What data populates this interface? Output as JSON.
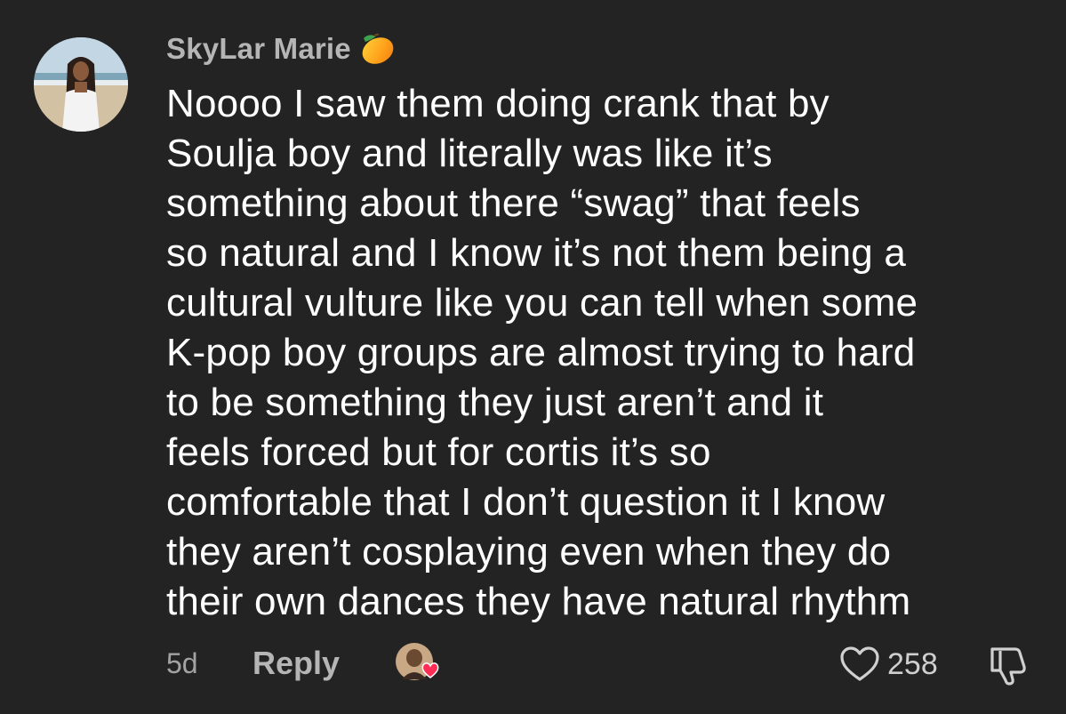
{
  "comment": {
    "username": "SkyLar Marie",
    "username_badge_icon": "mango-emoji",
    "text_lines": [
      "Noooo I saw them doing crank that by",
      "Soulja boy and literally was like it’s",
      "something about there “swag” that feels",
      "so natural and I know it’s not them being a",
      "cultural vulture like you can tell when some",
      "K-pop boy groups are almost trying to hard",
      "to be something they just aren’t and it",
      "feels forced but for cortis it’s so",
      "comfortable that I don’t question it I know",
      "they aren’t cosplaying even when they do",
      "their own dances they have natural rhythm"
    ],
    "timestamp": "5d",
    "reply_label": "Reply",
    "like_count": "258",
    "icons": {
      "like": "heart-outline-icon",
      "dislike": "thumbs-down-icon",
      "creator_liked": "creator-heart-icon"
    }
  },
  "colors": {
    "background": "#232323",
    "username": "#b5b5b5",
    "body_text": "#ffffff",
    "meta_text": "#a3a3a3",
    "heart_accent": "#ff2d55"
  }
}
